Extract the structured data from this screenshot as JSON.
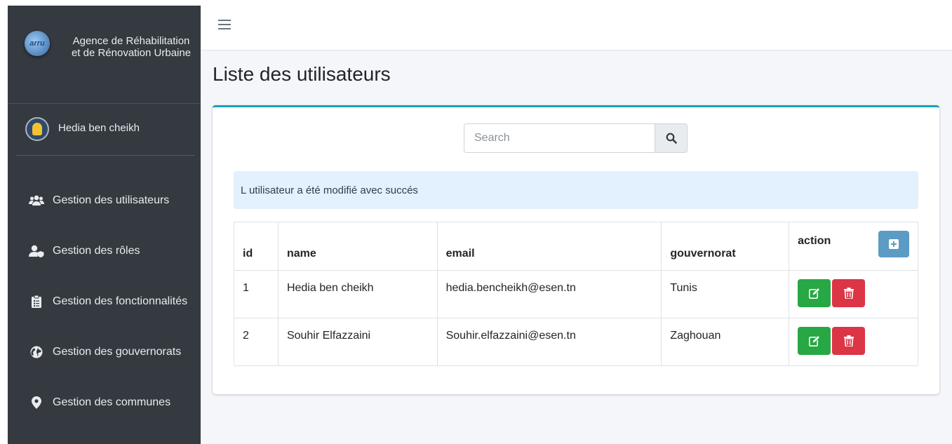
{
  "sidebar": {
    "brand_line1": "Agence de Réhabilitation",
    "brand_line2": "et de Rénovation Urbaine",
    "logo_text": "arru",
    "user_name": "Hedia ben cheikh",
    "items": [
      {
        "label": "Gestion des utilisateurs",
        "icon": "users-icon"
      },
      {
        "label": "Gestion des rôles",
        "icon": "user-shield-icon"
      },
      {
        "label": "Gestion des fonctionnalités",
        "icon": "clipboard-list-icon"
      },
      {
        "label": "Gestion des gouvernorats",
        "icon": "globe-icon"
      },
      {
        "label": "Gestion des communes",
        "icon": "map-marker-icon"
      }
    ]
  },
  "page": {
    "title": "Liste des utilisateurs"
  },
  "search": {
    "placeholder": "Search",
    "value": ""
  },
  "alert": {
    "text": "L utilisateur a été modifié avec succés"
  },
  "table": {
    "headers": {
      "id": "id",
      "name": "name",
      "email": "email",
      "gouvernorat": "gouvernorat",
      "action": "action"
    },
    "rows": [
      {
        "id": "1",
        "name": "Hedia ben cheikh",
        "email": "hedia.bencheikh@esen.tn",
        "gouvernorat": "Tunis"
      },
      {
        "id": "2",
        "name": "Souhir Elfazzaini",
        "email": "Souhir.elfazzaini@esen.tn",
        "gouvernorat": "Zaghouan"
      }
    ]
  },
  "colors": {
    "sidebar_bg": "#343a40",
    "card_accent": "#17a2b8",
    "edit_button": "#28a745",
    "delete_button": "#dc3545",
    "add_button": "#5b9bc4",
    "alert_bg": "#e3f0fd"
  }
}
